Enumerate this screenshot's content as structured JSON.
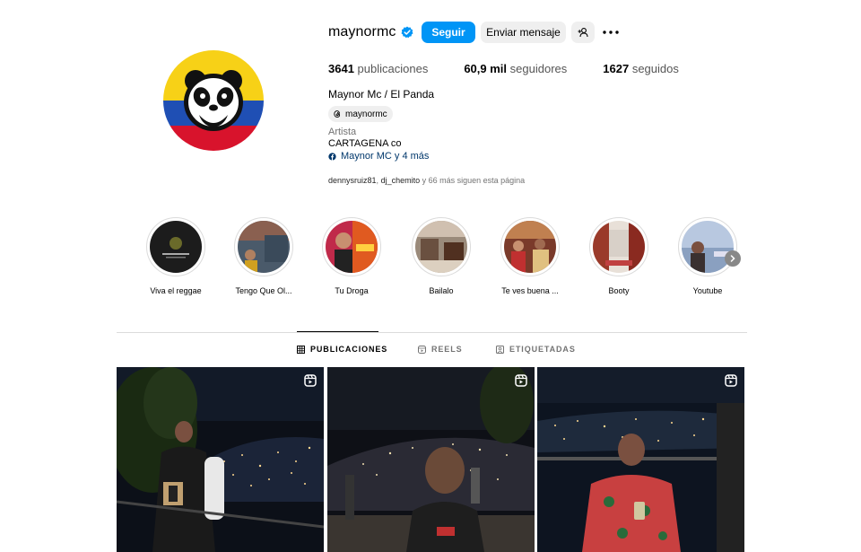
{
  "profile": {
    "username": "maynormc",
    "verified_icon": "verified-badge-icon",
    "follow_label": "Seguir",
    "message_label": "Enviar mensaje",
    "add_user_icon": "add-user-icon",
    "more_icon": "more-options-icon",
    "posts_count": "3641",
    "posts_label": "publicaciones",
    "followers_count": "60,9 mil",
    "followers_label": "seguidores",
    "following_count": "1627",
    "following_label": "seguidos",
    "full_name": "Maynor Mc / El Panda",
    "threads_handle": "maynormc",
    "category": "Artista",
    "bio": "CARTAGENA co",
    "link_text": "Maynor MC y 4 más",
    "followed_by_user1": "dennysruiz81",
    "followed_by_sep": ", ",
    "followed_by_user2": "dj_chemito",
    "followed_by_rest": " y 66 más siguen esta página"
  },
  "highlights": [
    {
      "label": "Viva el reggae"
    },
    {
      "label": "Tengo Que Ol..."
    },
    {
      "label": "Tu Droga"
    },
    {
      "label": "Bailalo"
    },
    {
      "label": "Te ves buena ..."
    },
    {
      "label": "Booty"
    },
    {
      "label": "Youtube"
    }
  ],
  "tabs": [
    {
      "label": "PUBLICACIONES",
      "icon": "grid-icon",
      "active": true
    },
    {
      "label": "REELS",
      "icon": "reels-icon",
      "active": false
    },
    {
      "label": "ETIQUETADAS",
      "icon": "tagged-icon",
      "active": false
    }
  ],
  "colors": {
    "accent": "#0095f6",
    "link": "#00376b",
    "flag_yellow": "#f7d117",
    "flag_blue": "#1f4fb4",
    "flag_red": "#d8132c"
  }
}
